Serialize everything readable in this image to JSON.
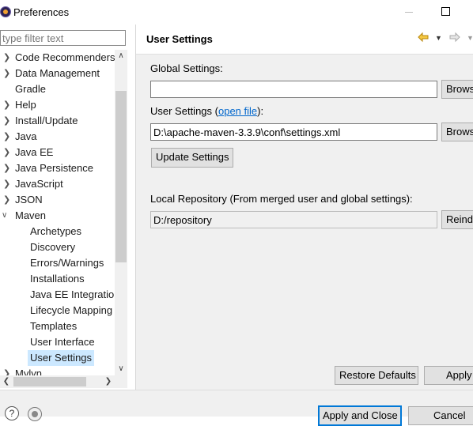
{
  "window": {
    "title": "Preferences"
  },
  "filter": {
    "placeholder": "type filter text"
  },
  "tree": {
    "items": [
      {
        "label": "Code Recommenders",
        "expandable": true
      },
      {
        "label": "Data Management",
        "expandable": true
      },
      {
        "label": "Gradle",
        "expandable": false
      },
      {
        "label": "Help",
        "expandable": true
      },
      {
        "label": "Install/Update",
        "expandable": true
      },
      {
        "label": "Java",
        "expandable": true
      },
      {
        "label": "Java EE",
        "expandable": true
      },
      {
        "label": "Java Persistence",
        "expandable": true
      },
      {
        "label": "JavaScript",
        "expandable": true
      },
      {
        "label": "JSON",
        "expandable": true
      },
      {
        "label": "Maven",
        "expanded": true
      },
      {
        "label": "Archetypes",
        "child": true
      },
      {
        "label": "Discovery",
        "child": true
      },
      {
        "label": "Errors/Warnings",
        "child": true
      },
      {
        "label": "Installations",
        "child": true
      },
      {
        "label": "Java EE Integration",
        "child": true
      },
      {
        "label": "Lifecycle Mapping",
        "child": true
      },
      {
        "label": "Templates",
        "child": true
      },
      {
        "label": "User Interface",
        "child": true
      },
      {
        "label": "User Settings",
        "child": true,
        "selected": true
      },
      {
        "label": "Mylyn",
        "expandable": true
      }
    ]
  },
  "page": {
    "title": "User Settings",
    "global_settings_label": "Global Settings:",
    "global_settings_value": "",
    "browse_label": "Browse...",
    "user_settings_label": "User Settings (",
    "open_file_link": "open file",
    "user_settings_label_end": "):",
    "user_settings_value": "D:\\apache-maven-3.3.9\\conf\\settings.xml",
    "update_settings_button": "Update Settings",
    "local_repo_label": "Local Repository (From merged user and global settings):",
    "local_repo_value": "D:/repository",
    "reindex_button": "Reindex",
    "restore_defaults_button": "Restore Defaults",
    "apply_button": "Apply"
  },
  "bottom": {
    "help_icon": "?",
    "apply_close_button": "Apply and Close",
    "cancel_button": "Cancel"
  },
  "colors": {
    "selection": "#cce8ff",
    "accent": "#0078d7",
    "link": "#0066cc"
  }
}
